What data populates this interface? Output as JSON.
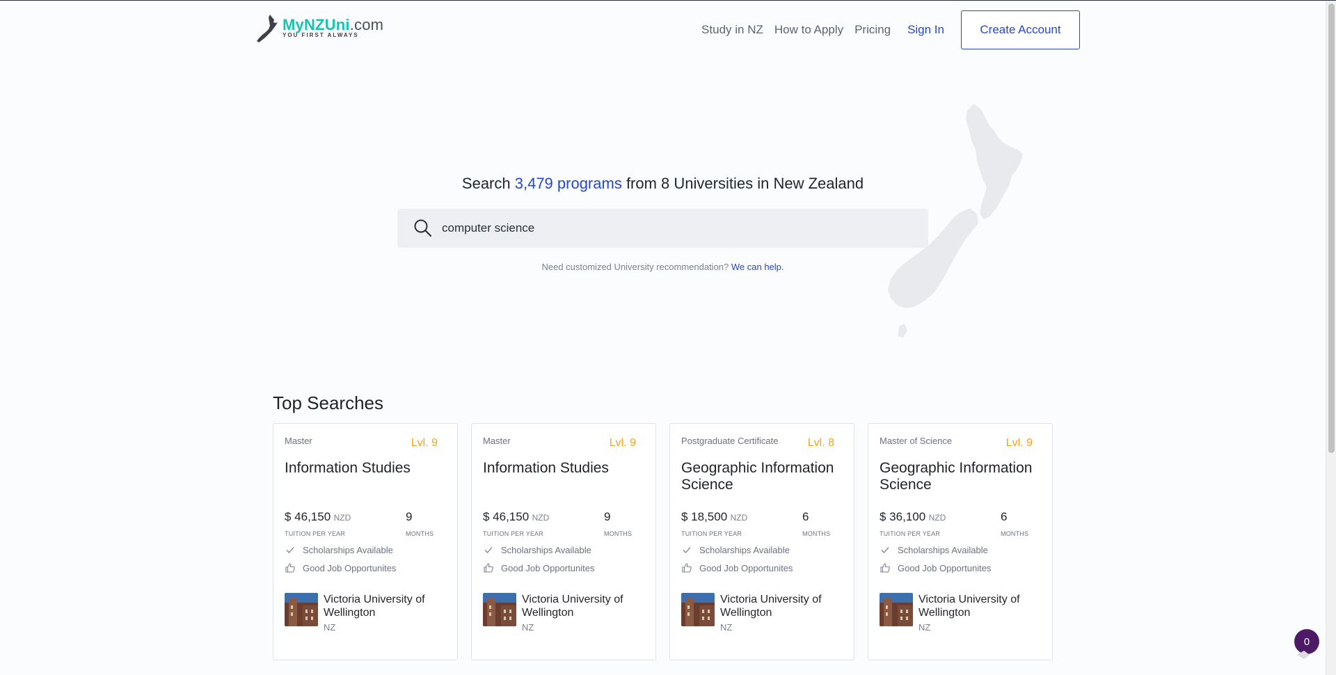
{
  "header": {
    "logo": {
      "my": "MyNZUni",
      "dotcom": ".com",
      "tagline": "YOU FIRST ALWAYS"
    },
    "nav": [
      {
        "label": "Study in NZ"
      },
      {
        "label": "How to Apply"
      },
      {
        "label": "Pricing"
      }
    ],
    "sign_in": "Sign In",
    "create_account": "Create Account"
  },
  "hero": {
    "title_prefix": "Search ",
    "title_count": "3,479 programs",
    "title_suffix": " from 8 Universities in New Zealand",
    "search_value": "computer science",
    "help_text": "Need customized University recommendation? ",
    "help_link": "We can help."
  },
  "top_searches": {
    "title": "Top Searches",
    "cards": [
      {
        "type": "Master",
        "level": "Lvl. 9",
        "title": "Information Studies",
        "price": "$ 46,150",
        "currency": "NZD",
        "price_label": "TUITION PER YEAR",
        "duration": "9",
        "duration_label": "MONTHS",
        "feature1": "Scholarships Available",
        "feature2": "Good Job Opportunites",
        "university": "Victoria University of Wellington",
        "country": "NZ"
      },
      {
        "type": "Master",
        "level": "Lvl. 9",
        "title": "Information Studies",
        "price": "$ 46,150",
        "currency": "NZD",
        "price_label": "TUITION PER YEAR",
        "duration": "9",
        "duration_label": "MONTHS",
        "feature1": "Scholarships Available",
        "feature2": "Good Job Opportunites",
        "university": "Victoria University of Wellington",
        "country": "NZ"
      },
      {
        "type": "Postgraduate Certificate",
        "level": "Lvl. 8",
        "title": "Geographic Information Science",
        "price": "$ 18,500",
        "currency": "NZD",
        "price_label": "TUITION PER YEAR",
        "duration": "6",
        "duration_label": "MONTHS",
        "feature1": "Scholarships Available",
        "feature2": "Good Job Opportunites",
        "university": "Victoria University of Wellington",
        "country": "NZ"
      },
      {
        "type": "Master of Science",
        "level": "Lvl. 9",
        "title": "Geographic Information Science",
        "price": "$ 36,100",
        "currency": "NZD",
        "price_label": "TUITION PER YEAR",
        "duration": "6",
        "duration_label": "MONTHS",
        "feature1": "Scholarships Available",
        "feature2": "Good Job Opportunites",
        "university": "Victoria University of Wellington",
        "country": "NZ"
      }
    ]
  },
  "chat_badge": {
    "count": "0"
  },
  "colors": {
    "accent": "#2746c8",
    "level": "#f5a21b",
    "logo": "#16c3b1",
    "badge": "#4d1a66"
  },
  "icons": [
    "search-icon",
    "check-icon",
    "thumbs-up-icon",
    "nz-map-icon",
    "chat-icon"
  ]
}
